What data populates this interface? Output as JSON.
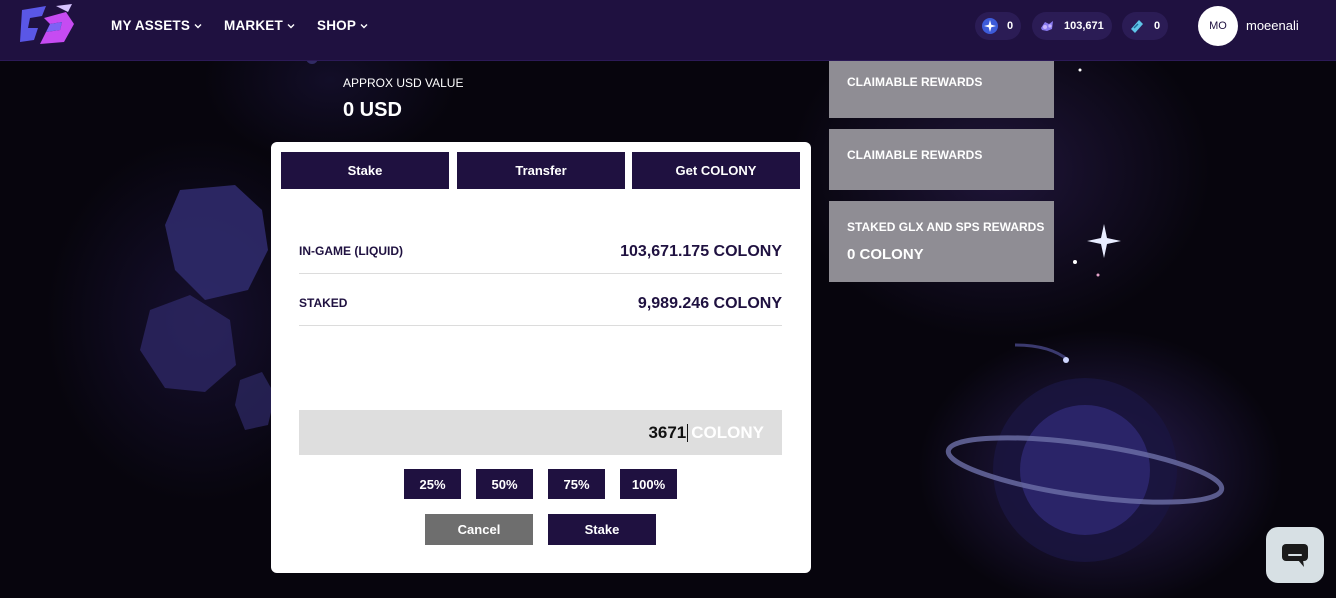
{
  "header": {
    "nav": [
      {
        "label": "MY ASSETS"
      },
      {
        "label": "MARKET"
      },
      {
        "label": "SHOP"
      }
    ],
    "balances": [
      {
        "icon": "star-token-icon",
        "value": "0"
      },
      {
        "icon": "colony-token-icon",
        "value": "103,671"
      },
      {
        "icon": "ticket-icon",
        "value": "0"
      }
    ],
    "avatar_initials": "MO",
    "username": "moeenali"
  },
  "background": {
    "approx_label": "APPROX USD VALUE",
    "approx_value": "0 USD",
    "reward_cards": [
      {
        "title": "CLAIMABLE REWARDS",
        "value": ""
      },
      {
        "title": "CLAIMABLE REWARDS",
        "value": ""
      },
      {
        "title": "STAKED GLX AND SPS REWARDS",
        "value": "0 COLONY"
      }
    ]
  },
  "modal": {
    "tabs": [
      {
        "label": "Stake"
      },
      {
        "label": "Transfer"
      },
      {
        "label": "Get COLONY"
      }
    ],
    "rows": [
      {
        "label": "IN-GAME (LIQUID)",
        "value": "103,671.175 COLONY"
      },
      {
        "label": "STAKED",
        "value": "9,989.246 COLONY"
      }
    ],
    "amount": {
      "value": "3671",
      "unit": "COLONY"
    },
    "percent_buttons": [
      {
        "label": "25%"
      },
      {
        "label": "50%"
      },
      {
        "label": "75%"
      },
      {
        "label": "100%"
      }
    ],
    "cancel_label": "Cancel",
    "stake_label": "Stake"
  },
  "colors": {
    "primary": "#1f1140",
    "cancel": "#6e6e6e",
    "card": "#8f8d94"
  }
}
